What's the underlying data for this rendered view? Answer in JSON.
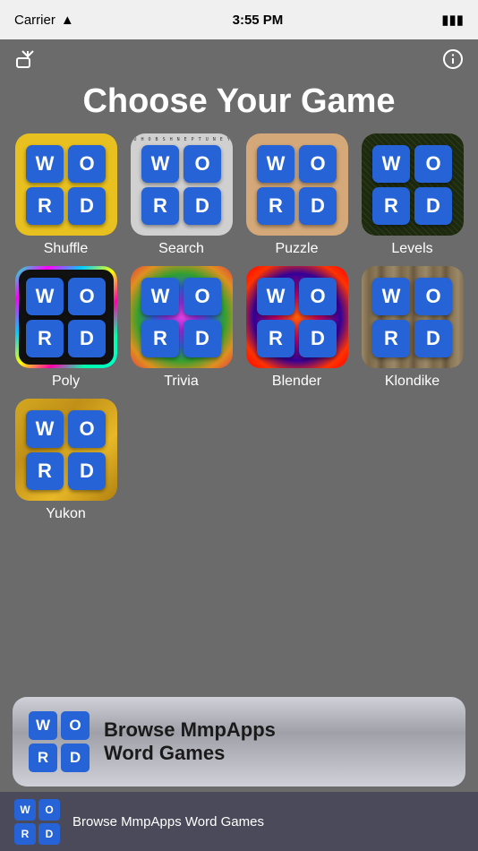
{
  "statusBar": {
    "carrier": "Carrier",
    "time": "3:55 PM",
    "wifi": "wifi",
    "battery": "battery"
  },
  "topBar": {
    "shareIcon": "↗",
    "infoIcon": "ⓘ"
  },
  "title": "Choose Your Game",
  "games": [
    {
      "id": "shuffle",
      "label": "Shuffle",
      "bg": "shuffle",
      "tiles": [
        "W",
        "O",
        "R",
        "D"
      ]
    },
    {
      "id": "search",
      "label": "Search",
      "bg": "search",
      "tiles": [
        "W",
        "O",
        "R",
        "D"
      ]
    },
    {
      "id": "puzzle",
      "label": "Puzzle",
      "bg": "puzzle",
      "tiles": [
        "W",
        "O",
        "R",
        "D"
      ]
    },
    {
      "id": "levels",
      "label": "Levels",
      "bg": "levels",
      "tiles": [
        "W",
        "O",
        "R",
        "D"
      ]
    },
    {
      "id": "poly",
      "label": "Poly",
      "bg": "poly",
      "tiles": [
        "W",
        "O",
        "R",
        "D"
      ]
    },
    {
      "id": "trivia",
      "label": "Trivia",
      "bg": "trivia",
      "tiles": [
        "W",
        "O",
        "R",
        "D"
      ]
    },
    {
      "id": "blender",
      "label": "Blender",
      "bg": "blender",
      "tiles": [
        "W",
        "O",
        "R",
        "D"
      ]
    },
    {
      "id": "klondike",
      "label": "Klondike",
      "bg": "klondike",
      "tiles": [
        "W",
        "O",
        "R",
        "D"
      ]
    },
    {
      "id": "yukon",
      "label": "Yukon",
      "bg": "yukon",
      "tiles": [
        "W",
        "O",
        "R",
        "D"
      ]
    }
  ],
  "browseBanner": {
    "text": "Browse MmpApps\nWord Games",
    "tiles": [
      "W",
      "O",
      "R",
      "D"
    ]
  },
  "bottomBar": {
    "text": "Browse MmpApps Word Games",
    "tiles": [
      "W",
      "O",
      "R",
      "D"
    ]
  }
}
